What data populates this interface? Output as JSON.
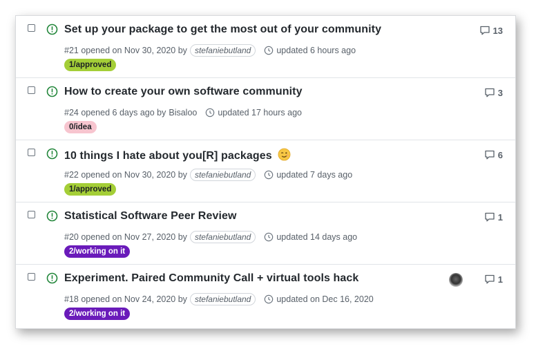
{
  "colors": {
    "open_icon": "#22863a",
    "approved_bg": "#a4ce37",
    "idea_bg": "#f7c5cf",
    "working_bg": "#6a1bba"
  },
  "issues": [
    {
      "title": "Set up your package to get the most out of your community",
      "meta_prefix": "#21 opened on Nov 30, 2020 by",
      "author": "stefaniebutland",
      "updated": "updated 6 hours ago",
      "label": "1/approved",
      "comments": "13"
    },
    {
      "title": "How to create your own software community",
      "meta_prefix": "#24 opened 6 days ago by",
      "author": "Bisaloo",
      "updated": "updated 17 hours ago",
      "label": "0/idea",
      "comments": "3"
    },
    {
      "title": "10 things I hate about you[R] packages",
      "meta_prefix": "#22 opened on Nov 30, 2020 by",
      "author": "stefaniebutland",
      "updated": "updated 7 days ago",
      "label": "1/approved",
      "comments": "6"
    },
    {
      "title": "Statistical Software Peer Review",
      "meta_prefix": "#20 opened on Nov 27, 2020 by",
      "author": "stefaniebutland",
      "updated": "updated 14 days ago",
      "label": "2/working on it",
      "comments": "1"
    },
    {
      "title": "Experiment. Paired Community Call + virtual tools hack",
      "meta_prefix": "#18 opened on Nov 24, 2020 by",
      "author": "stefaniebutland",
      "updated": "updated on Dec 16, 2020",
      "label": "2/working on it",
      "comments": "1"
    }
  ]
}
